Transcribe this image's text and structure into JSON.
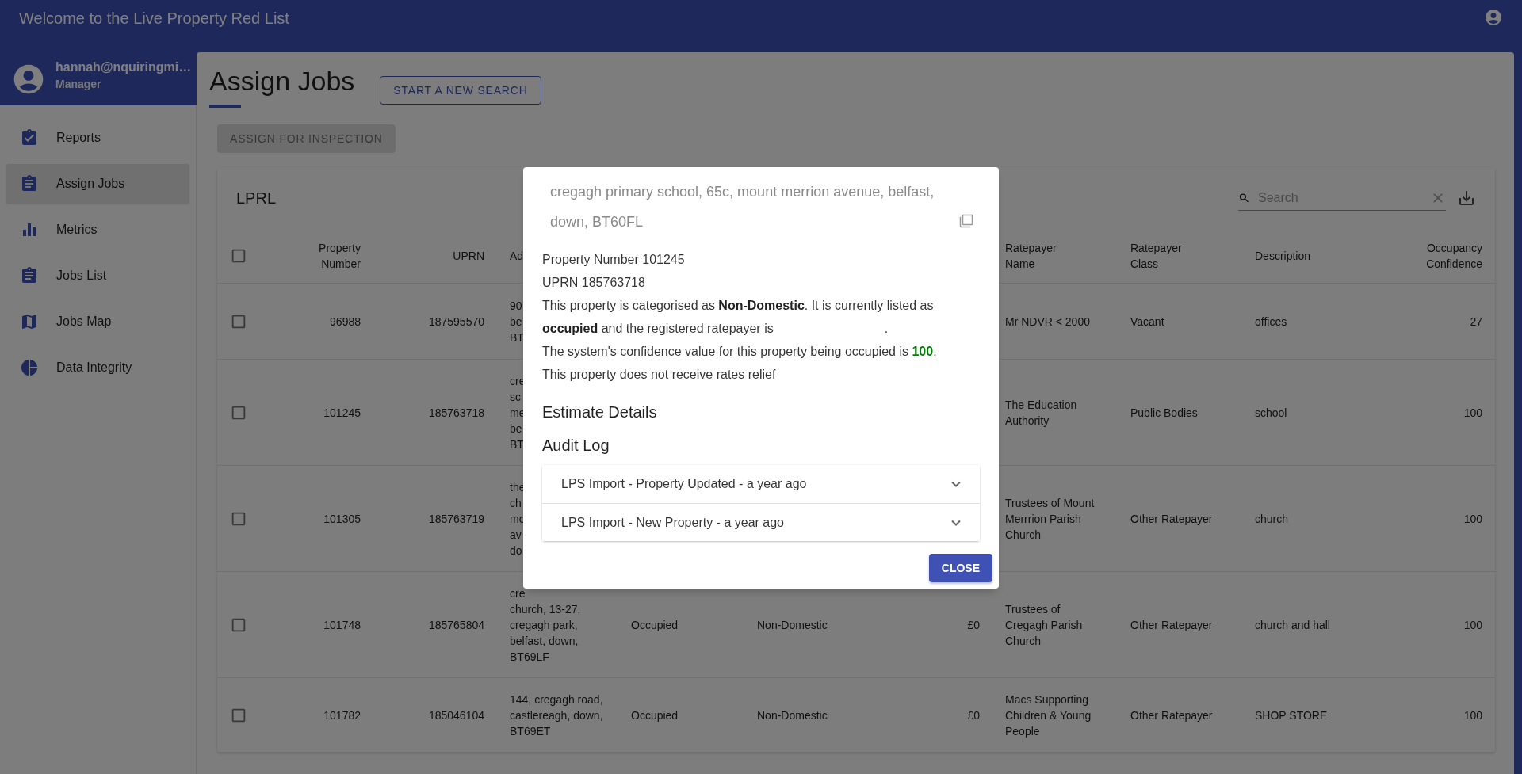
{
  "app_bar": {
    "title": "Welcome to the Live Property Red List"
  },
  "user": {
    "email": "hannah@nquiringmi…",
    "role": "Manager"
  },
  "sidebar": {
    "items": [
      {
        "label": "Reports",
        "selected": false
      },
      {
        "label": "Assign Jobs",
        "selected": true
      },
      {
        "label": "Metrics",
        "selected": false
      },
      {
        "label": "Jobs List",
        "selected": false
      },
      {
        "label": "Jobs Map",
        "selected": false
      },
      {
        "label": "Data Integrity",
        "selected": false
      }
    ]
  },
  "page": {
    "title": "Assign Jobs",
    "new_search_button": "START A NEW SEARCH",
    "assign_button": {
      "label": "ASSIGN FOR INSPECTION",
      "disabled": true
    }
  },
  "table": {
    "title": "LPRL",
    "search": {
      "placeholder": "Search"
    },
    "select_all_checked": false,
    "columns": [
      "Property Number",
      "UPRN",
      "Ad",
      "Ratepayer Name",
      "Ratepayer Class",
      "Description",
      "Occupancy Confidence"
    ],
    "rows": [
      {
        "checked": false,
        "property_number": "96988",
        "uprn": "187595570",
        "column_3": [
          "90",
          "be",
          "BT"
        ],
        "ratepayer_name": "Mr NDVR < 2000",
        "ratepayer_class": "Vacant",
        "description": "offices",
        "occupancy_confidence": "27"
      },
      {
        "checked": false,
        "property_number": "101245",
        "uprn": "185763718",
        "column_3": [
          "cre",
          "sc",
          "me",
          "be",
          "BT"
        ],
        "ratepayer_name": "The Education Authority",
        "ratepayer_class": "Public Bodies",
        "description": "school",
        "occupancy_confidence": "100"
      },
      {
        "checked": false,
        "property_number": "101305",
        "uprn": "185763719",
        "column_3": [
          "the",
          "ch",
          "mo",
          "av",
          "do"
        ],
        "ratepayer_name": "Trustees of Mount Merrrion Parish Church",
        "ratepayer_class": "Other Ratepayer",
        "description": "church",
        "occupancy_confidence": "100"
      },
      {
        "checked": false,
        "property_number": "101748",
        "uprn": "185765804",
        "column_3": [
          "cre",
          "church, 13-27,",
          "cregagh park,",
          "belfast, down,",
          "BT69LF"
        ],
        "column_4": "Occupied",
        "column_5": "Non-Domestic",
        "column_6": "£0",
        "ratepayer_name": "Trustees of Cregagh Parish Church",
        "ratepayer_class": "Other Ratepayer",
        "description": "church and hall",
        "occupancy_confidence": "100"
      },
      {
        "checked": false,
        "property_number": "101782",
        "uprn": "185046104",
        "column_3": [
          "144, cregagh road,",
          "castlereagh, down,",
          "BT69ET"
        ],
        "column_4": "Occupied",
        "column_5": "Non-Domestic",
        "column_6": "£0",
        "ratepayer_name": "Macs Supporting Children & Young People",
        "ratepayer_class": "Other Ratepayer",
        "description": "SHOP STORE",
        "occupancy_confidence": "100"
      }
    ]
  },
  "dialog": {
    "heading": "cregagh primary school, 65c, mount merrion avenue, belfast, down, BT60FL",
    "lines": [
      "Property Number 101245",
      "UPRN 185763718"
    ],
    "category_sentence": {
      "before": "This property is categorised as **Non-Domestic**. It is currently listed as **occupied** and the registered ratepayer is",
      "after": "."
    },
    "confidence_sentence": {
      "before": "The system's confidence value for this property being occupied is",
      "value": "100",
      "after": "."
    },
    "relief_line": "This property does not receive rates relief",
    "estimate_heading": "Estimate Details",
    "audit_heading": "Audit Log",
    "audit_log": [
      {
        "label": "LPS Import - Property Updated - a year ago",
        "expanded": false
      },
      {
        "label": "LPS Import - New Property - a year ago",
        "expanded": false
      }
    ],
    "close_button": "CLOSE"
  }
}
